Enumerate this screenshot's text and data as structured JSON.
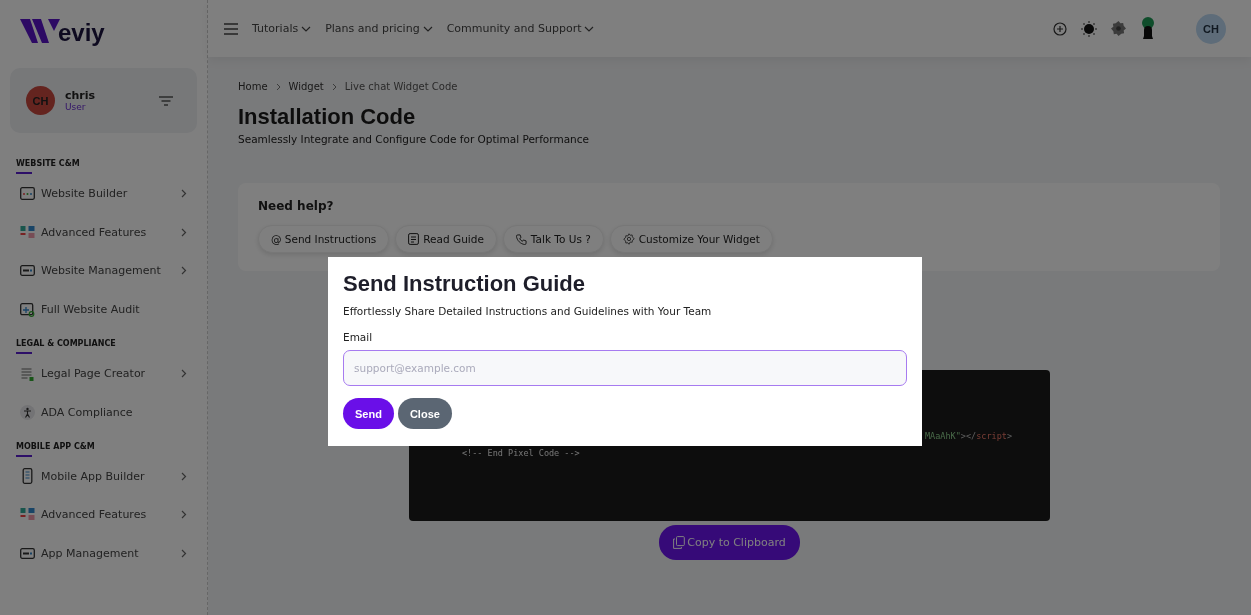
{
  "brand": {
    "text": "eviy"
  },
  "user": {
    "initials": "CH",
    "name": "chris",
    "role": "User"
  },
  "sidebar": {
    "sections": [
      {
        "title": "WEBSITE C&M",
        "items": [
          {
            "label": "Website Builder",
            "kind": "browser",
            "arrow": true
          },
          {
            "label": "Advanced Features",
            "kind": "grid",
            "arrow": true
          },
          {
            "label": "Website Management",
            "kind": "panel",
            "arrow": true
          },
          {
            "label": "Full Website Audit",
            "kind": "audit",
            "arrow": false
          }
        ]
      },
      {
        "title": "LEGAL & COMPLIANCE",
        "items": [
          {
            "label": "Legal Page Creator",
            "kind": "document",
            "arrow": true
          },
          {
            "label": "ADA Compliance",
            "kind": "person",
            "arrow": false
          }
        ]
      },
      {
        "title": "MOBILE APP C&M",
        "items": [
          {
            "label": "Mobile App Builder",
            "kind": "phone",
            "arrow": true
          },
          {
            "label": "Advanced Features",
            "kind": "grid",
            "arrow": true
          },
          {
            "label": "App Management",
            "kind": "panel",
            "arrow": true
          }
        ]
      }
    ]
  },
  "topnav": [
    "Tutorials",
    "Plans and pricing",
    "Community and Support"
  ],
  "top_avatar": "CH",
  "breadcrumb": [
    "Home",
    "Widget",
    "Live chat Widget Code"
  ],
  "title": "Installation Code",
  "subtitle": "Seamlessly Integrate and Configure Code for Optimal Performance",
  "help": {
    "title": "Need help?",
    "buttons": [
      {
        "label": "@ Send Instructions",
        "kind": "none"
      },
      {
        "label": "Read Guide",
        "kind": "guide"
      },
      {
        "label": "Talk To Us ?",
        "kind": "phone"
      },
      {
        "label": "Customize Your Widget",
        "kind": "gear"
      }
    ]
  },
  "code_lines": [
    [
      {
        "text": "MAaAhK\"",
        "kind": "string"
      },
      {
        "text": "></",
        "kind": "punct"
      },
      {
        "text": "script",
        "kind": "tag"
      },
      {
        "text": ">",
        "kind": "punct"
      }
    ],
    [
      {
        "text": "<!-- End Pixel Code -->",
        "kind": "comment"
      }
    ]
  ],
  "copy_button": "Copy to Clipboard",
  "modal": {
    "title": "Send Instruction Guide",
    "subtitle": "Effortlessly Share Detailed Instructions and Guidelines with Your Team",
    "email_label": "Email",
    "placeholder": "support@example.com",
    "send": "Send",
    "close": "Close"
  }
}
